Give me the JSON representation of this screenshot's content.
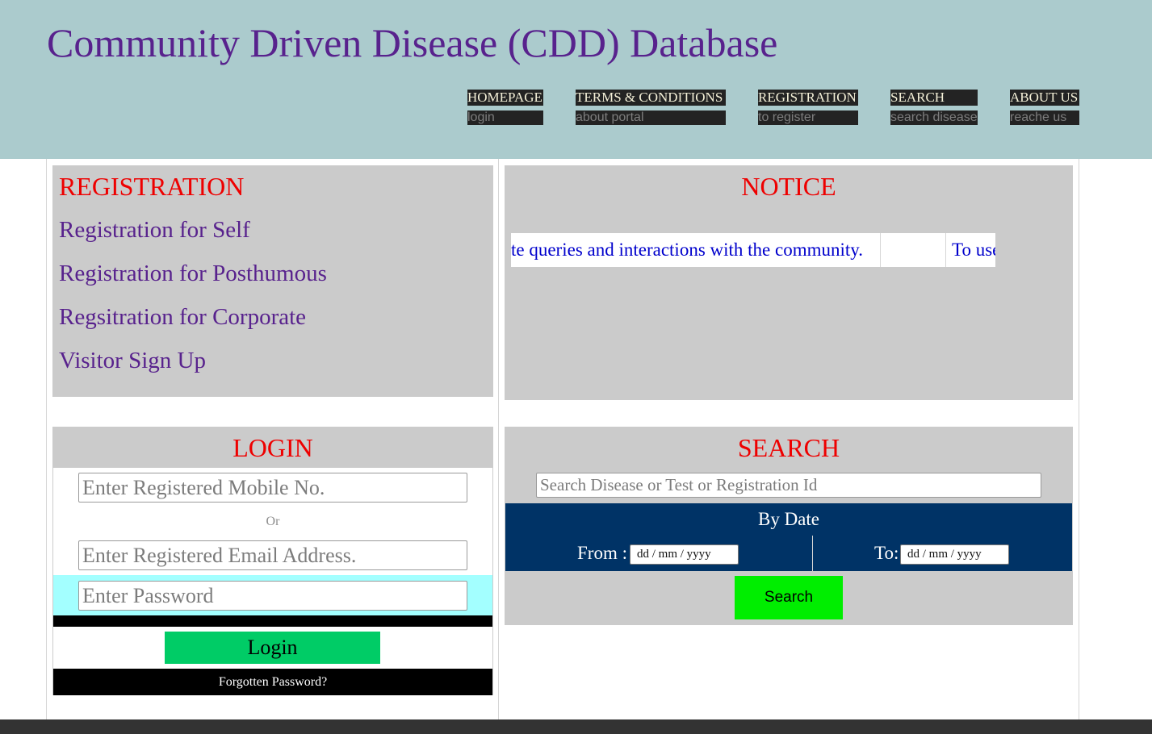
{
  "header": {
    "title": "Community Driven Disease (CDD) Database"
  },
  "nav": [
    {
      "label": "HOMEPAGE",
      "sub": "login"
    },
    {
      "label": "TERMS & CONDITIONS",
      "sub": "about portal"
    },
    {
      "label": "REGISTRATION",
      "sub": "to register"
    },
    {
      "label": "SEARCH",
      "sub": "search disease"
    },
    {
      "label": "ABOUT US",
      "sub": "reache us"
    }
  ],
  "registration": {
    "heading": "REGISTRATION",
    "links": [
      "Registration for Self",
      "Registration for Posthumous",
      "Regsitration for Corporate",
      "Visitor Sign Up"
    ]
  },
  "notice": {
    "heading": "NOTICE",
    "items": [
      "te queries and interactions with the community.",
      "",
      "To use"
    ]
  },
  "login": {
    "heading": "LOGIN",
    "mobile_placeholder": "Enter Registered Mobile No.",
    "or_text": "Or",
    "email_placeholder": "Enter Registered Email Address.",
    "password_placeholder": "Enter Password",
    "button_label": "Login",
    "forgot_label": "Forgotten Password?"
  },
  "search": {
    "heading": "SEARCH",
    "input_placeholder": "Search Disease or Test or Registration Id",
    "by_date_title": "By Date",
    "from_label": "From :",
    "from_value": "dd / mm / yyyy",
    "to_label": "To:",
    "to_value": "dd / mm / yyyy",
    "button_label": "Search"
  },
  "colors": {
    "header_bg": "#abcbcd",
    "title": "#58228d",
    "heading_red": "#ee0000",
    "panel_gray": "#cbcbcb",
    "by_date_bg": "#003366",
    "login_button": "#00cc66",
    "search_button": "#00ee00",
    "password_band": "#a3ffff"
  }
}
